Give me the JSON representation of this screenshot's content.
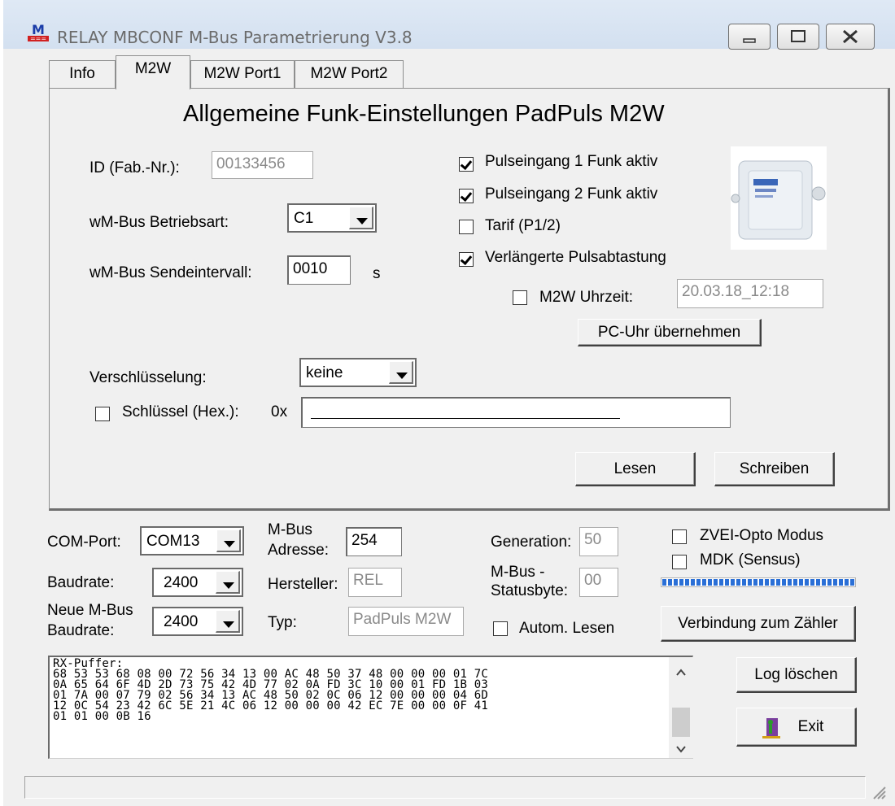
{
  "window": {
    "title": "RELAY MBCONF  M-Bus Parametrierung  V3.8"
  },
  "tabs": [
    {
      "label": "Info",
      "hotkey": "o"
    },
    {
      "label": "M2W"
    },
    {
      "label": "M2W Port1",
      "hotkey": "1"
    },
    {
      "label": "M2W Port2",
      "hotkey": "2"
    }
  ],
  "panel": {
    "heading": "Allgemeine Funk-Einstellungen PadPuls M2W",
    "id_label": "ID (Fab.-Nr.):",
    "id_value": "00133456",
    "mode_label": "wM-Bus Betriebsart:",
    "mode_value": "C1",
    "interval_label": "wM-Bus Sendeintervall:",
    "interval_value": "0010",
    "interval_unit": "s",
    "pulse1_label": "Pulseingang 1 Funk aktiv",
    "pulse1_checked": true,
    "pulse2_label": "Pulseingang 2 Funk aktiv",
    "pulse2_checked": true,
    "tarif_label": "Tarif (P1/2)",
    "tarif_checked": false,
    "extended_label": "Verlängerte Pulsabtastung",
    "extended_checked": true,
    "clock_label": "M2W Uhrzeit:",
    "clock_checked": false,
    "clock_value": "20.03.18_12:18",
    "pc_clock_button": "PC-Uhr übernehmen",
    "encryption_label": "Verschlüsselung:",
    "encryption_value": "keine",
    "key_label": "Schlüssel (Hex.):",
    "key_checked": false,
    "key_prefix": "0x",
    "key_value": "",
    "read_button": "Lesen",
    "write_button": "Schreiben"
  },
  "connection": {
    "com_label": "COM-Port:",
    "com_value": "COM13",
    "baud_label": "Baudrate:",
    "baud_value": "2400",
    "new_baud_label_1": "Neue M-Bus",
    "new_baud_label_2": "Baudrate:",
    "new_baud_value": "2400",
    "addr_label_1": "M-Bus",
    "addr_label_2": "Adresse:",
    "addr_value": "254",
    "manufacturer_label": "Hersteller:",
    "manufacturer_value": "REL",
    "type_label": "Typ:",
    "type_value": "PadPuls M2W",
    "generation_label": "Generation:",
    "generation_value": "50",
    "status_label_1": "M-Bus -",
    "status_label_2": "Statusbyte:",
    "status_value": "00",
    "auto_read_label": "Autom. Lesen",
    "auto_read_checked": false,
    "zvei_label": "ZVEI-Opto Modus",
    "zvei_checked": false,
    "mdk_label": "MDK (Sensus)",
    "mdk_checked": false,
    "progress": 1.0,
    "connect_button": "Verbindung zum Zähler"
  },
  "log": {
    "text": "RX-Puffer:\n68 53 53 68 08 00 72 56 34 13 00 AC 48 50 37 48 00 00 00 01 7C\n0A 65 64 6F 4D 2D 73 75 42 4D 77 02 0A FD 3C 10 00 01 FD 1B 03\n01 7A 00 07 79 02 56 34 13 AC 48 50 02 0C 06 12 00 00 00 04 6D\n12 0C 54 23 42 6C 5E 21 4C 06 12 00 00 00 42 EC 7E 00 00 0F 41\n01 01 00 0B 16",
    "clear_button": "Log löschen",
    "exit_button": "Exit"
  },
  "colors": {
    "progress": "#2a6fd6",
    "dialog_bg": "#f0f0f0"
  }
}
